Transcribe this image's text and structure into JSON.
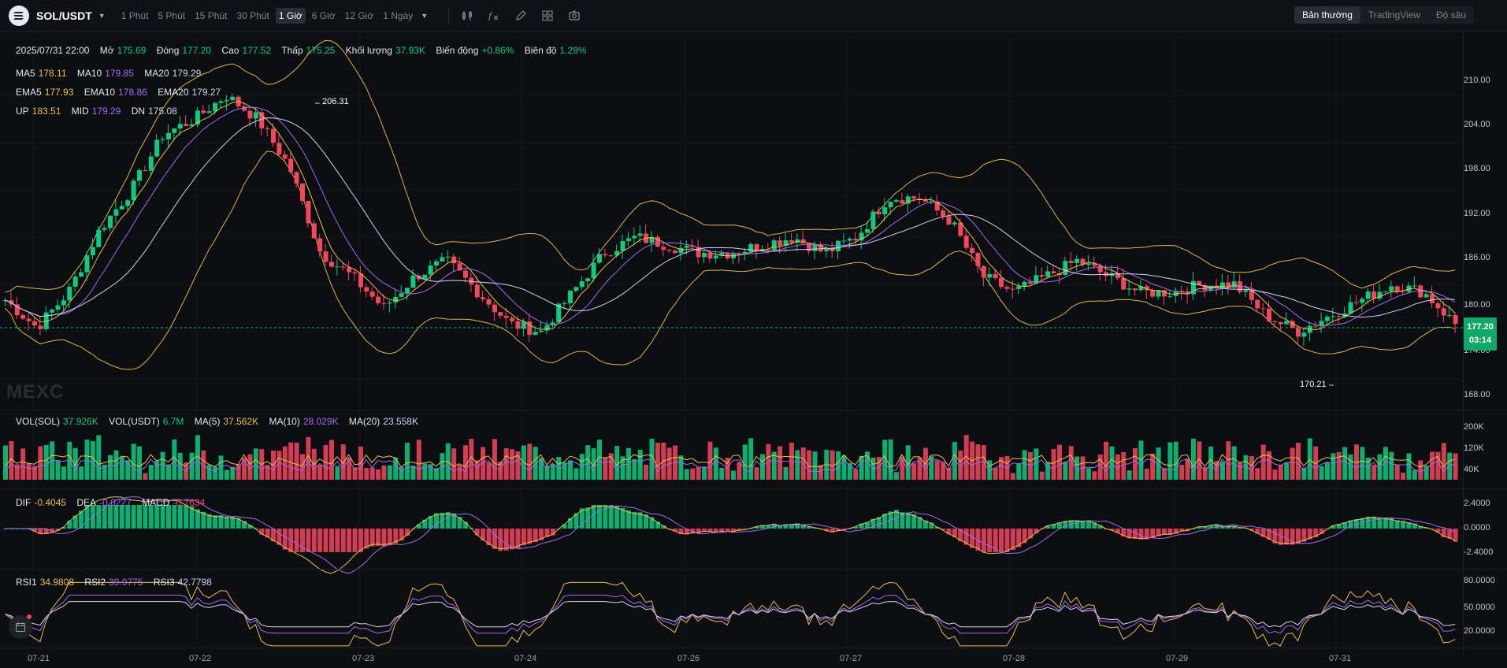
{
  "toolbar": {
    "pair": "SOL/USDT",
    "intervals": [
      "1 Phút",
      "5 Phút",
      "15 Phút",
      "30 Phút",
      "1 Giờ",
      "6 Giờ",
      "12 Giờ",
      "1 Ngày"
    ],
    "active_interval": "1 Giờ",
    "view_tabs": [
      "Bản thường",
      "TradingView",
      "Độ sâu"
    ],
    "active_view": "Bản thường",
    "icons": [
      "candlestick-style-icon",
      "indicator-fx-icon",
      "draw-pen-icon",
      "layout-grid-icon",
      "screenshot-camera-icon"
    ]
  },
  "ohlc": {
    "date": "2025/07/31 22:00",
    "open_label": "Mở",
    "open": "175.69",
    "close_label": "Đóng",
    "close": "177.20",
    "high_label": "Cao",
    "high": "177.52",
    "low_label": "Thấp",
    "low": "175.25",
    "volume_label": "Khối lượng",
    "volume": "37.93K",
    "change_label": "Biến động",
    "change": "+0.86%",
    "amplitude_label": "Biên độ",
    "amplitude": "1.29%"
  },
  "ma": {
    "ma5_label": "MA5",
    "ma5": "178.11",
    "ma10_label": "MA10",
    "ma10": "179.85",
    "ma20_label": "MA20",
    "ma20": "179.29"
  },
  "ema": {
    "ema5_label": "EMA5",
    "ema5": "177.93",
    "ema10_label": "EMA10",
    "ema10": "178.86",
    "ema20_label": "EMA20",
    "ema20": "179.27"
  },
  "boll": {
    "up_label": "UP",
    "up": "183.51",
    "mid_label": "MID",
    "mid": "179.29",
    "dn_label": "DN",
    "dn": "175.08"
  },
  "price_axis": [
    "210.00",
    "204.00",
    "198.00",
    "192.00",
    "186.00",
    "180.00",
    "174.00",
    "168.00"
  ],
  "current_price": "177.20",
  "countdown": "03:14",
  "high_marker": "206.31",
  "low_marker": "170.21",
  "watermark": "MEXC",
  "vol": {
    "sol_label": "VOL(SOL)",
    "sol": "37.926K",
    "usdt_label": "VOL(USDT)",
    "usdt": "6.7M",
    "ma5_label": "MA(5)",
    "ma5": "37.562K",
    "ma10_label": "MA(10)",
    "ma10": "28.029K",
    "ma20_label": "MA(20)",
    "ma20": "23.558K",
    "axis": [
      "200K",
      "120K",
      "40K"
    ]
  },
  "macd": {
    "dif_label": "DIF",
    "dif": "-0.4045",
    "dea_label": "DEA",
    "dea": "-0.0227",
    "macd_label": "MACD",
    "macd": "-0.7634",
    "axis": [
      "2.4000",
      "0.0000",
      "-2.4000"
    ]
  },
  "rsi": {
    "rsi1_label": "RSI1",
    "rsi1": "34.9808",
    "rsi2_label": "RSI2",
    "rsi2": "39.9775",
    "rsi3_label": "RSI3",
    "rsi3": "42.7798",
    "axis": [
      "80.0000",
      "50.0000",
      "20.0000"
    ]
  },
  "x_axis": [
    "07-21",
    "07-22",
    "07-23",
    "07-24",
    "07-26",
    "07-27",
    "07-28",
    "07-29",
    "07-31"
  ],
  "colors": {
    "up": "#0ecb81",
    "down": "#f6465d",
    "ma5": "#e8c04a",
    "ma10": "#a06cf0",
    "ma20": "#cfd3ee",
    "boll": "#d9b64c",
    "badge": "#10a868"
  },
  "chart_data": {
    "type": "candlestick",
    "price_range": [
      166,
      214
    ],
    "key_prices": [
      180,
      176.5,
      181,
      189,
      194,
      201,
      203,
      206,
      203,
      197,
      186,
      183,
      179,
      183,
      185,
      181,
      177,
      176,
      181,
      186,
      188,
      187,
      186,
      186,
      187,
      188,
      186,
      188,
      193,
      193,
      190,
      183,
      181,
      183,
      185,
      183,
      181,
      181,
      182,
      182,
      178,
      176,
      178,
      180,
      182,
      181,
      177
    ]
  }
}
